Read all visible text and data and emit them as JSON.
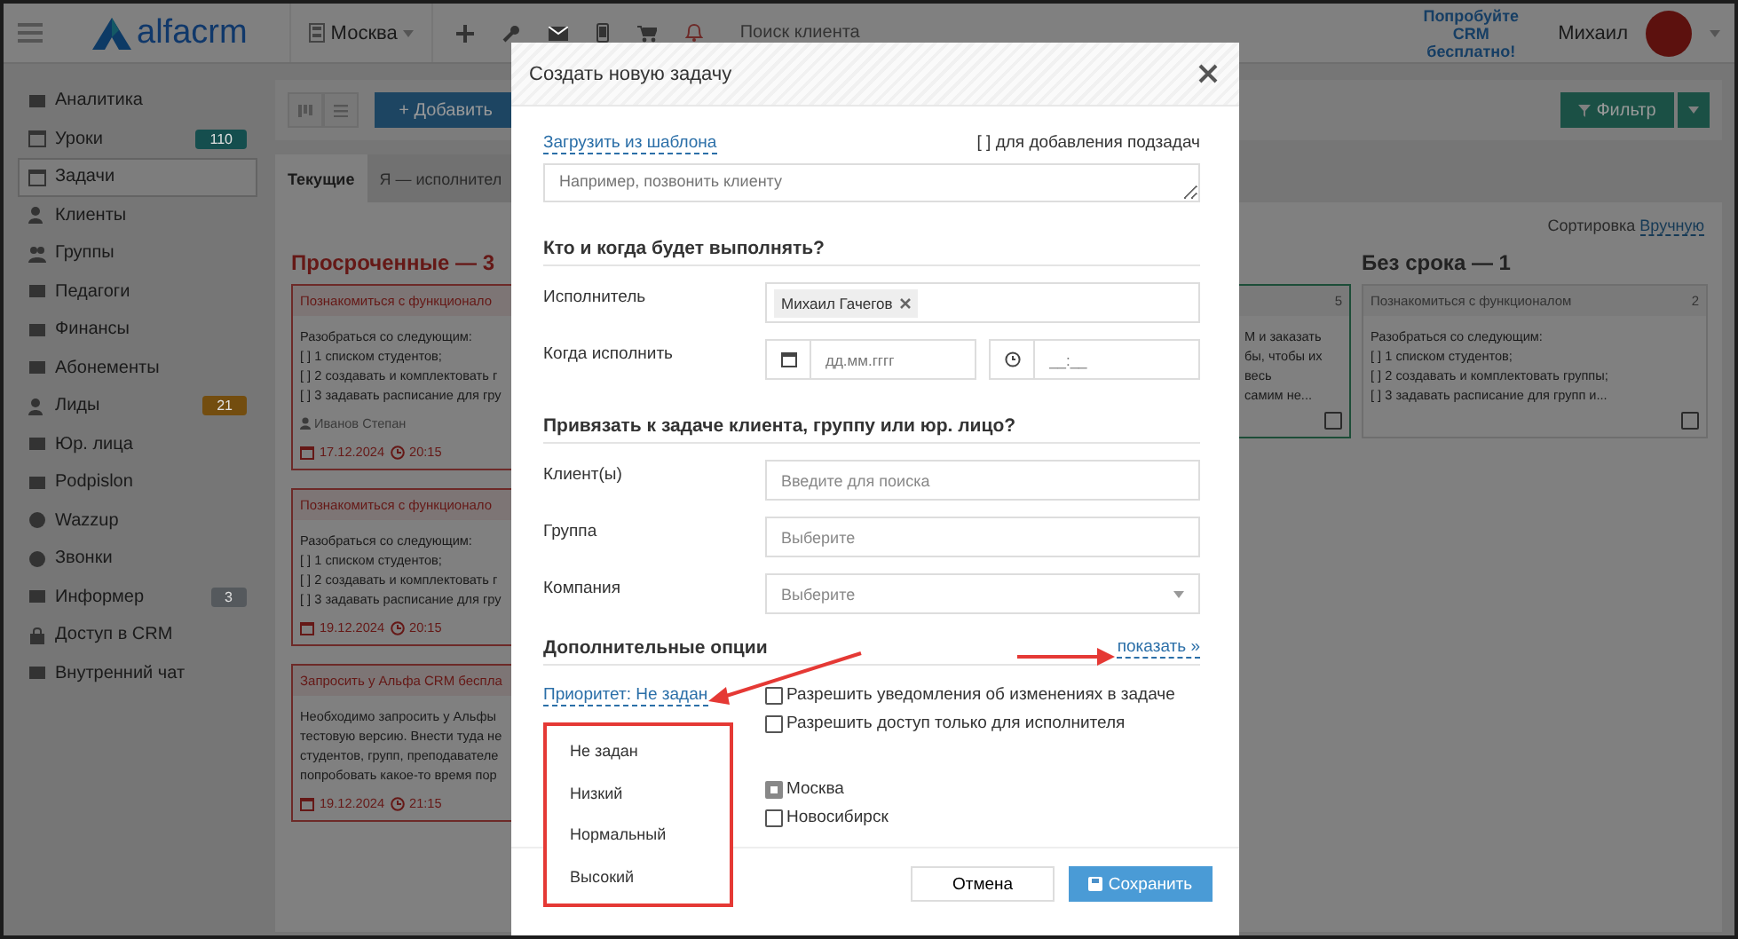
{
  "topbar": {
    "logo": "alfacrm",
    "city": "Москва",
    "search_placeholder": "Поиск клиента",
    "promo": "Попробуйте CRM бесплатно!",
    "user": "Михаил"
  },
  "sidebar": {
    "items": [
      {
        "label": "Аналитика",
        "selected": false
      },
      {
        "label": "Уроки",
        "selected": false,
        "badge": "110",
        "color": "#154e4e"
      },
      {
        "label": "Задачи",
        "selected": true
      },
      {
        "label": "Клиенты",
        "selected": false
      },
      {
        "label": "Группы",
        "selected": false
      },
      {
        "label": "Педагоги",
        "selected": false
      },
      {
        "label": "Финансы",
        "selected": false
      },
      {
        "label": "Абонементы",
        "selected": false
      },
      {
        "label": "Лиды",
        "selected": false,
        "badge": "21",
        "color": "#734d0f"
      },
      {
        "label": "Юр. лица",
        "selected": false
      },
      {
        "label": "Podpislon",
        "selected": false
      },
      {
        "label": "Wazzup",
        "selected": false
      },
      {
        "label": "Звонки",
        "selected": false
      },
      {
        "label": "Информер",
        "selected": false,
        "badge": "3",
        "color": "#55595d"
      },
      {
        "label": "Доступ в CRM",
        "selected": false
      },
      {
        "label": "Внутренний чат",
        "selected": false
      }
    ]
  },
  "toolbar": {
    "add_button": "+ Добавить",
    "filter_button": "Фильтр"
  },
  "tabs": [
    {
      "label": "Текущие",
      "selected": true
    },
    {
      "label": "Я — исполнител",
      "selected": false
    }
  ],
  "board": {
    "sort_label": "Сортировка",
    "sort_value": "Вручную",
    "columns": [
      {
        "kind": "overdue",
        "title": "Просроченные — 3",
        "cards": [
          {
            "title": "Познакомиться с функционало",
            "lines": [
              "Разобраться со следующим:",
              "[ ] 1 списком студентов;",
              "[ ] 2 создавать и комплектовать г",
              "[ ] 3 задавать расписание для гру"
            ],
            "author": "Иванов Степан",
            "date": "17.12.2024",
            "time": "20:15"
          },
          {
            "title": "Познакомиться с функционало",
            "lines": [
              "Разобраться со следующим:",
              "[ ] 1 списком студентов;",
              "[ ] 2 создавать и комплектовать г",
              "[ ] 3 задавать расписание для гру"
            ],
            "date": "19.12.2024",
            "time": "20:15"
          },
          {
            "title": "Запросить у Альфа CRM беспла",
            "lines": [
              "Необходимо запросить у Альфы",
              "тестовую версию. Внести туда не",
              "студентов, групп, преподавателе",
              "попробовать какое-то время пор"
            ],
            "date": "19.12.2024",
            "time": "21:15"
          }
        ]
      },
      {
        "kind": "hidden"
      },
      {
        "kind": "active",
        "cards": [
          {
            "count": "5",
            "lines": [
              "М и заказать",
              "бы, чтобы их",
              "весь",
              "самим не..."
            ],
            "done": false
          }
        ]
      },
      {
        "kind": "nodate",
        "title": "Без срока — 1",
        "cards": [
          {
            "title": "Познакомиться с функционалом",
            "count": "2",
            "lines": [
              "Разобраться со следующим:",
              "[ ] 1 списком студентов;",
              "[ ] 2 создавать и комплектовать группы;",
              "[ ] 3 задавать расписание для групп и..."
            ],
            "done": false
          }
        ]
      }
    ]
  },
  "modal": {
    "title": "Создать новую задачу",
    "template_link": "Загрузить из шаблона",
    "subtask_hint": "[ ] для добавления подзадач",
    "task_placeholder": "Например, позвонить клиенту",
    "section_who": "Кто и когда будет выполнять?",
    "assignee_label": "Исполнитель",
    "assignee": "Михаил Гачегов",
    "when_label": "Когда исполнить",
    "date_placeholder": "дд.мм.гггг",
    "time_placeholder": "__:__",
    "section_link": "Привязать к задаче клиента, группу или юр. лицо?",
    "link_fields": [
      {
        "kind": "search",
        "label": "Клиент(ы)",
        "placeholder": "Введите для поиска"
      },
      {
        "kind": "text",
        "label": "Группа",
        "placeholder": "Выберите"
      },
      {
        "kind": "select",
        "label": "Компания",
        "placeholder": "Выберите"
      }
    ],
    "section_extra": "Дополнительные опции",
    "show_link": "показать »",
    "priority_link": "Приоритет: Не задан",
    "priority_options": [
      "Не задан",
      "Низкий",
      "Нормальный",
      "Высокий"
    ],
    "options": [
      {
        "label": "Разрешить уведомления об изменениях в задаче",
        "checked": false
      },
      {
        "label": "Разрешить доступ только для исполнителя",
        "checked": false
      }
    ],
    "branches": [
      {
        "label": "Москва",
        "checked": true
      },
      {
        "label": "Новосибирск",
        "checked": false
      }
    ],
    "cancel_button": "Отмена",
    "save_button": "Сохранить"
  }
}
